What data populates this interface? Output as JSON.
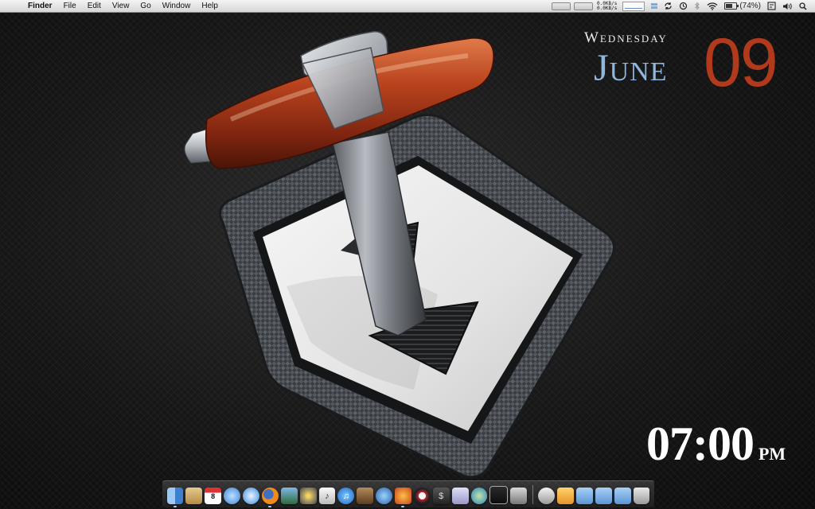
{
  "menubar": {
    "apple_glyph": "",
    "items": [
      "Finder",
      "File",
      "Edit",
      "View",
      "Go",
      "Window",
      "Help"
    ],
    "net_up": "0.0KB/s",
    "net_down": "0.0KB/s",
    "battery": "(74%)"
  },
  "date_widget": {
    "weekday": "Wednesday",
    "month": "June",
    "day": "09"
  },
  "clock": {
    "time": "07:00",
    "ampm": "PM"
  },
  "icons": {
    "menubar_extras": [
      "cpu-meter-icon",
      "memory-meter-icon",
      "network-graph-icon",
      "disk-bars-icon",
      "sync-icon",
      "time-machine-icon",
      "bluetooth-icon",
      "wifi-icon",
      "battery-icon",
      "input-menu-icon",
      "volume-icon",
      "spotlight-icon"
    ],
    "dock": [
      "finder-icon",
      "address-book-icon",
      "ical-icon",
      "ichat-icon",
      "safari-icon",
      "firefox-icon",
      "iphoto-icon",
      "imovie-icon",
      "itunes-icon",
      "garageband-icon",
      "network-utility-icon",
      "blender-icon",
      "transmission-icon",
      "terminal-icon",
      "textedit-icon",
      "system-prefs-icon",
      "activity-monitor-icon",
      "preview-icon",
      "downloads-stack-icon",
      "documents-folder-icon",
      "applications-folder-icon",
      "trash-icon"
    ]
  },
  "colors": {
    "weekday": "#eaeaea",
    "month": "#8fb6de",
    "day": "#b23a1c",
    "clock": "#ffffff",
    "menubar_bg": "#e4e4e4"
  }
}
